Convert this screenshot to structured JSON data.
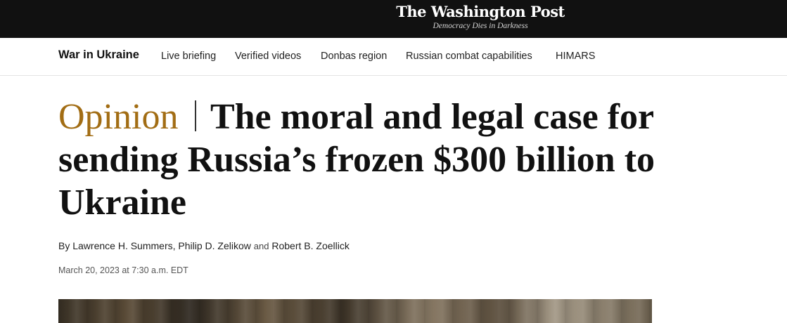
{
  "masthead": {
    "logo": "The Washington Post",
    "tagline": "Democracy Dies in Darkness"
  },
  "subnav": {
    "section_title": "War in Ukraine",
    "links": [
      "Live briefing",
      "Verified videos",
      "Donbas region",
      "Russian combat capabilities",
      "HIMARS"
    ]
  },
  "article": {
    "kicker": "Opinion",
    "headline": "The moral and legal case for sending Russia’s frozen $300 billion to Ukraine",
    "byline_prefix": "By",
    "authors": [
      "Lawrence H. Summers",
      "Philip D. Zelikow",
      "Robert B. Zoellick"
    ],
    "author_separator": ",",
    "author_conjunction": "and",
    "timestamp": "March 20, 2023 at 7:30 a.m. EDT"
  },
  "colors": {
    "topbar": "#111111",
    "kicker": "#a26d14"
  }
}
